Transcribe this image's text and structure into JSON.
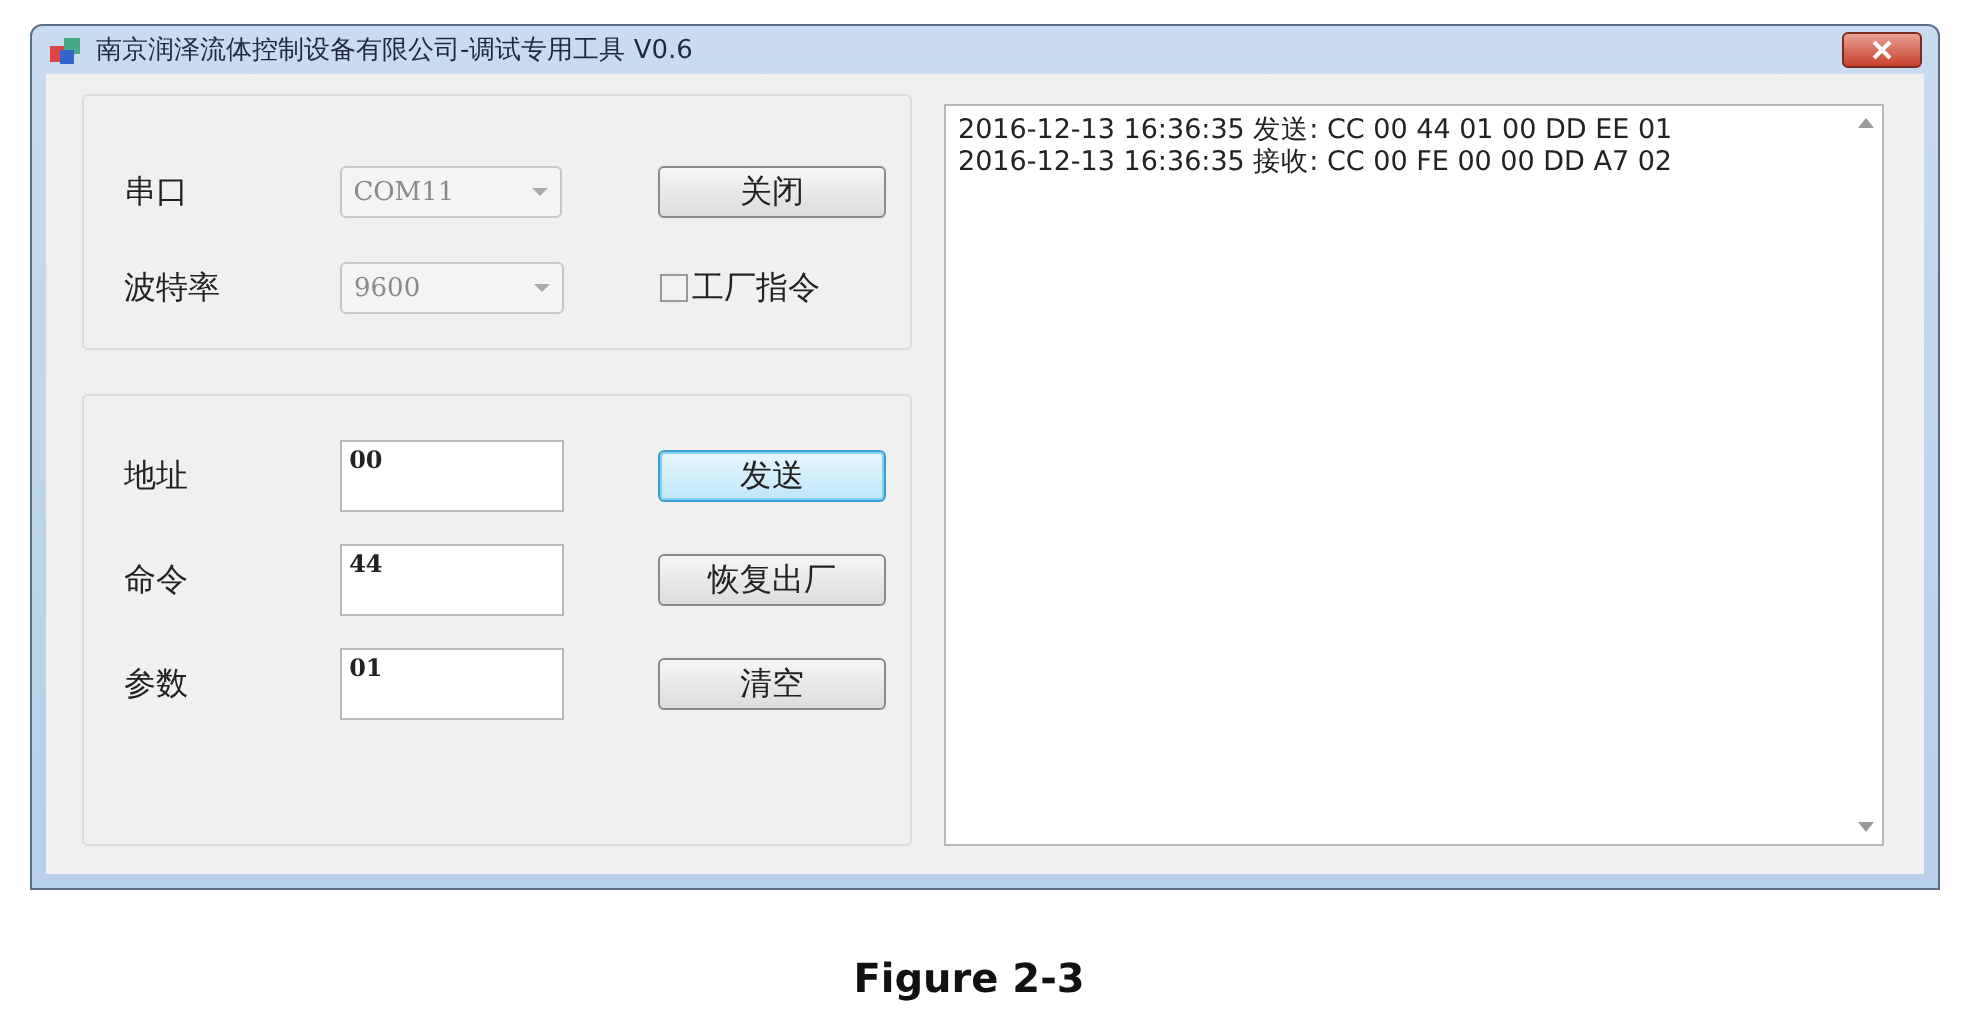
{
  "window": {
    "title": "南京润泽流体控制设备有限公司-调试专用工具 V0.6"
  },
  "port_group": {
    "rows": [
      {
        "label": "串口",
        "value": "COM11",
        "disabled": true
      },
      {
        "label": "波特率",
        "value": "9600",
        "disabled": true
      }
    ],
    "close_button": {
      "label": "关闭",
      "focused": false
    },
    "factory_checkbox": {
      "label": "工厂指令",
      "checked": false
    }
  },
  "command_group": {
    "rows": [
      {
        "label": "地址",
        "value": "00",
        "button": {
          "label": "发送",
          "focused": true
        }
      },
      {
        "label": "命令",
        "value": "44",
        "button": {
          "label": "恢复出厂",
          "focused": false
        }
      },
      {
        "label": "参数",
        "value": "01",
        "button": {
          "label": "清空",
          "focused": false
        }
      }
    ]
  },
  "log": {
    "lines": [
      "2016-12-13 16:36:35 发送: CC 00 44 01 00 DD EE 01",
      "2016-12-13 16:36:35 接收: CC 00 FE 00 00 DD A7 02"
    ]
  },
  "caption": "Figure 2-3"
}
